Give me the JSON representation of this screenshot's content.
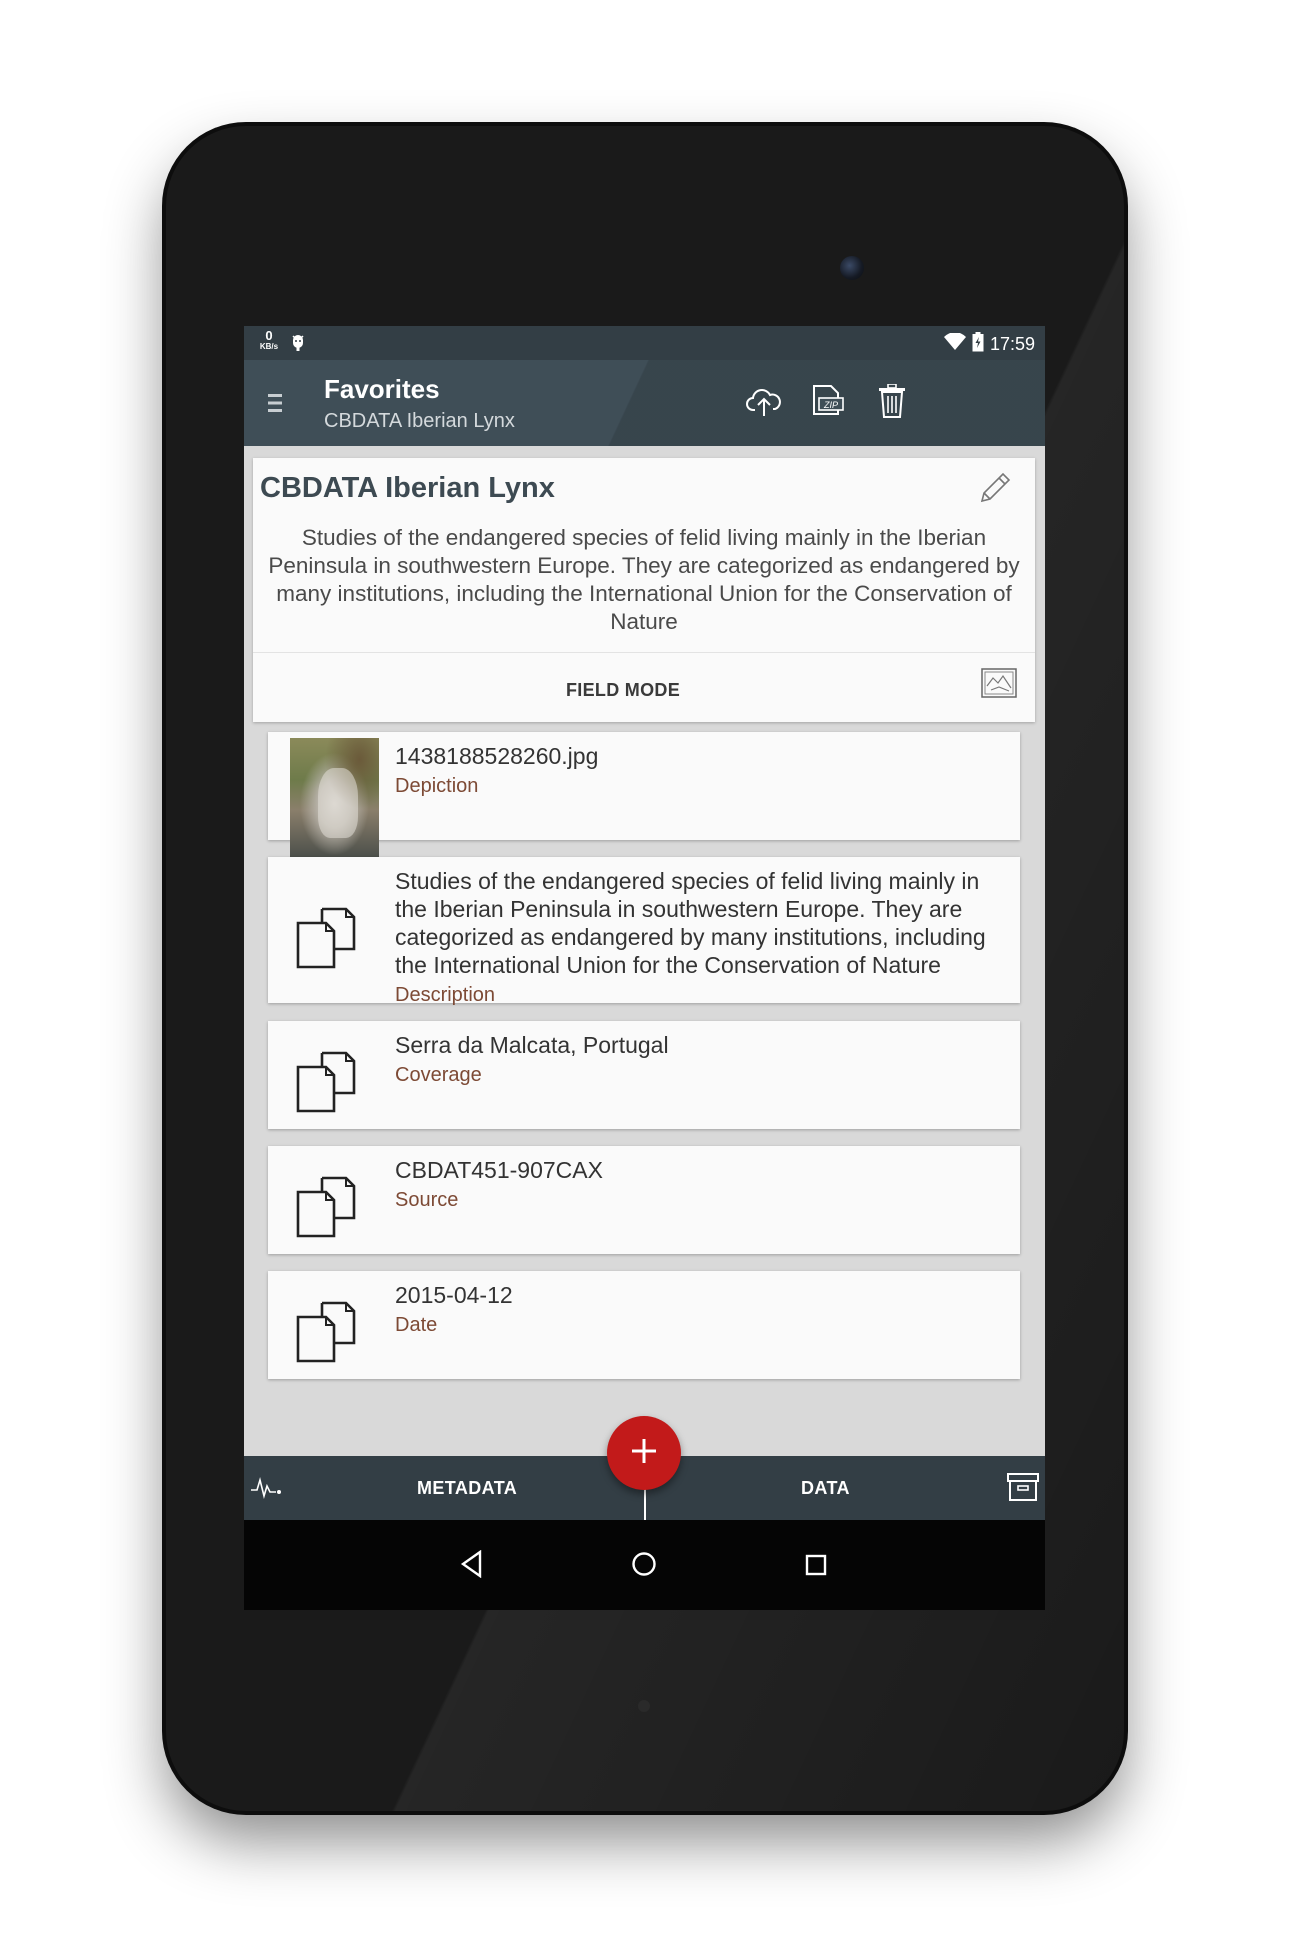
{
  "status_bar": {
    "net_speed_value": "0",
    "net_speed_unit": "KB/s",
    "time": "17:59"
  },
  "toolbar": {
    "title": "Favorites",
    "subtitle": "CBDATA Iberian Lynx"
  },
  "header_card": {
    "title": "CBDATA Iberian Lynx",
    "description": "Studies of the endangered species of felid living mainly in the Iberian Peninsula in southwestern Europe. They are categorized as endangered by many institutions, including the International Union for the Conservation of Nature",
    "field_mode_label": "FIELD MODE"
  },
  "items": [
    {
      "value": "1438188528260.jpg",
      "label": "Depiction",
      "icon": "image-thumbnail"
    },
    {
      "value": "Studies of the endangered species of felid living mainly in the Iberian Peninsula in southwestern Europe. They are categorized as endangered by many institutions, including the International Union for the Conservation of Nature",
      "label": "Description",
      "icon": "documents-icon"
    },
    {
      "value": "Serra da Malcata, Portugal",
      "label": "Coverage",
      "icon": "documents-icon"
    },
    {
      "value": "CBDAT451-907CAX",
      "label": "Source",
      "icon": "documents-icon"
    },
    {
      "value": "2015-04-12",
      "label": "Date",
      "icon": "documents-icon"
    }
  ],
  "bottom_bar": {
    "tab_metadata": "METADATA",
    "tab_data": "DATA"
  },
  "colors": {
    "toolbar": "#3f4e57",
    "status_bar": "#333e45",
    "fab": "#c21a1a",
    "field_label": "#7d4a35"
  }
}
